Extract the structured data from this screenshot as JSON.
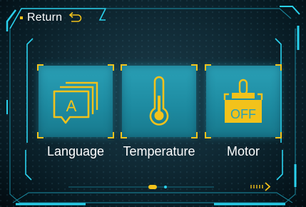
{
  "header": {
    "return_label": "Return",
    "return_icon": "return-arrow-icon"
  },
  "menu": {
    "items": [
      {
        "label": "Language",
        "icon": "language-icon"
      },
      {
        "label": "Temperature",
        "icon": "thermometer-icon"
      },
      {
        "label": "Motor",
        "icon": "motor-icon",
        "icon_text": "OFF"
      }
    ]
  },
  "pager": {
    "current_page": 1,
    "total_pages": 2
  },
  "navigation": {
    "next_icon": "next-page-arrow-icon"
  },
  "colors": {
    "accent_yellow": "#f2c21b",
    "frame_cyan": "#2ad2ee",
    "tile_teal": "#2aa0b6",
    "background": "#0a1e28"
  }
}
